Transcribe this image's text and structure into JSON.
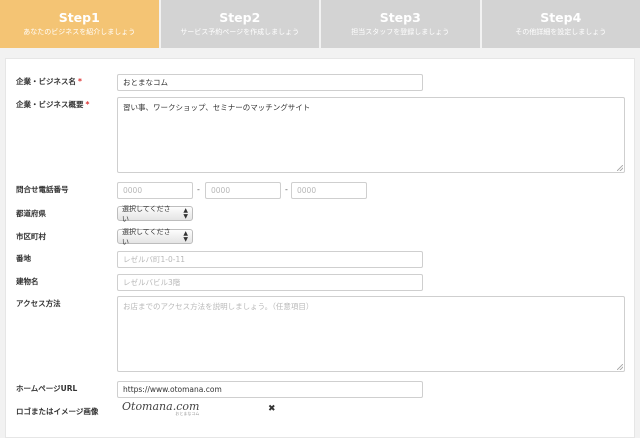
{
  "steps": [
    {
      "title": "Step1",
      "subtitle": "あなたのビジネスを紹介しましょう"
    },
    {
      "title": "Step2",
      "subtitle": "サービス予約ページを作成しましょう"
    },
    {
      "title": "Step3",
      "subtitle": "担当スタッフを登録しましょう"
    },
    {
      "title": "Step4",
      "subtitle": "その他詳細を設定しましょう"
    }
  ],
  "form": {
    "company_name": {
      "label": "企業・ビジネス名",
      "required": "*",
      "value": "おとまなコム"
    },
    "company_overview": {
      "label": "企業・ビジネス概要",
      "required": "*",
      "value": "習い事、ワークショップ、セミナーのマッチングサイト"
    },
    "phone": {
      "label": "問合せ電話番号",
      "part1": "0000",
      "part2": "0000",
      "part3": "0000",
      "sep": "-"
    },
    "prefecture": {
      "label": "都道府県",
      "selected": "選択してください"
    },
    "city": {
      "label": "市区町村",
      "selected": "選択してください"
    },
    "address": {
      "label": "番地",
      "placeholder": "レゼルバ町1-0-11"
    },
    "building": {
      "label": "建物名",
      "placeholder": "レゼルバビル3階"
    },
    "access": {
      "label": "アクセス方法",
      "placeholder": "お店までのアクセス方法を説明しましょう。（任意項目）"
    },
    "homepage": {
      "label": "ホームページURL",
      "value": "https://www.otomana.com"
    },
    "logo": {
      "label": "ロゴまたはイメージ画像",
      "brand_text": "Otomana.com",
      "sub_text": "おとまなコム",
      "remove": "✖"
    }
  }
}
